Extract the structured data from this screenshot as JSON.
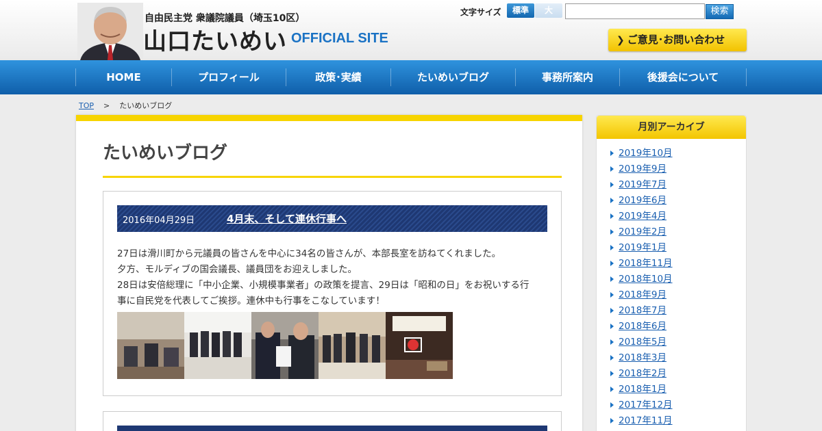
{
  "header": {
    "subtitle": "自由民主党 衆議院議員（埼玉10区）",
    "site_name": "山口たいめい",
    "official": "OFFICIAL SITE",
    "font_size_label": "文字サイズ",
    "font_size_normal": "標準",
    "font_size_large": "大",
    "search_value": "",
    "search_button": "検索",
    "contact_button": "ご意見･お問い合わせ"
  },
  "nav": {
    "items": [
      {
        "label": "HOME"
      },
      {
        "label": "プロフィール"
      },
      {
        "label": "政策･実績"
      },
      {
        "label": "たいめいブログ"
      },
      {
        "label": "事務所案内"
      },
      {
        "label": "後援会について"
      }
    ]
  },
  "breadcrumb": {
    "top": "TOP",
    "sep": ">",
    "current": "たいめいブログ"
  },
  "main": {
    "page_title": "たいめいブログ",
    "post": {
      "date": "2016年04月29日",
      "title": "4月末、そして連休行事へ",
      "lines": [
        "27日は滑川町から元議員の皆さんを中心に34名の皆さんが、本部長室を訪ねてくれました。",
        "夕方、モルディブの国会議長、議員団をお迎えしました。",
        "28日は安倍総理に「中小企業、小規模事業者」の政策を提言、29日は「昭和の日」をお祝いする行",
        "事に自民党を代表してご挨拶。連休中も行事をこなしています！"
      ]
    }
  },
  "sidebar": {
    "title": "月別アーカイブ",
    "archives": [
      "2019年10月",
      "2019年9月",
      "2019年7月",
      "2019年6月",
      "2019年4月",
      "2019年2月",
      "2019年1月",
      "2018年11月",
      "2018年10月",
      "2018年9月",
      "2018年7月",
      "2018年6月",
      "2018年5月",
      "2018年3月",
      "2018年2月",
      "2018年1月",
      "2017年12月",
      "2017年11月"
    ]
  },
  "colors": {
    "nav_blue": "#1a72c4",
    "accent_yellow": "#f7d400",
    "post_header_navy": "#1e3873"
  }
}
